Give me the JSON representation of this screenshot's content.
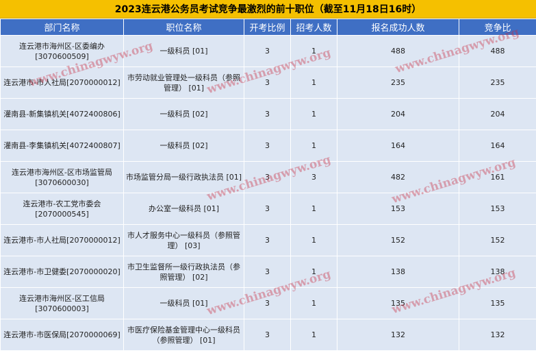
{
  "title": "2023连云港公务员考试竞争最激烈的前十职位（截至11月18日16时）",
  "columns": [
    "部门名称",
    "职位名称",
    "开考比例",
    "招考人数",
    "报名成功人数",
    "竞争比"
  ],
  "rows": [
    {
      "dept": "连云港市海州区-区委编办[3070600509]",
      "position": "一级科员 [01]",
      "ratio": "3",
      "hires": "1",
      "applicants": "488",
      "competition": "488"
    },
    {
      "dept": "连云港市-市人社局[2070000012]",
      "position": "市劳动就业管理处一级科员（参照管理） [01]",
      "ratio": "3",
      "hires": "1",
      "applicants": "235",
      "competition": "235"
    },
    {
      "dept": "灌南县-新集镇机关[4072400806]",
      "position": "一级科员 [02]",
      "ratio": "3",
      "hires": "1",
      "applicants": "204",
      "competition": "204"
    },
    {
      "dept": "灌南县-李集镇机关[4072400807]",
      "position": "一级科员 [02]",
      "ratio": "3",
      "hires": "1",
      "applicants": "164",
      "competition": "164"
    },
    {
      "dept": "连云港市海州区-区市场监管局 [3070600030]",
      "position": "市场监管分局一级行政执法员 [01]",
      "ratio": "3",
      "hires": "3",
      "applicants": "482",
      "competition": "161"
    },
    {
      "dept": "连云港市-农工党市委会[2070000545]",
      "position": "办公室一级科员 [01]",
      "ratio": "3",
      "hires": "1",
      "applicants": "153",
      "competition": "153"
    },
    {
      "dept": "连云港市-市人社局[2070000012]",
      "position": "市人才服务中心一级科员（参照管理） [03]",
      "ratio": "3",
      "hires": "1",
      "applicants": "152",
      "competition": "152"
    },
    {
      "dept": "连云港市-市卫健委[2070000020]",
      "position": "市卫生监督所一级行政执法员（参照管理） [02]",
      "ratio": "3",
      "hires": "1",
      "applicants": "138",
      "competition": "138"
    },
    {
      "dept": "连云港市海州区-区工信局[3070600003]",
      "position": "一级科员 [01]",
      "ratio": "3",
      "hires": "1",
      "applicants": "135",
      "competition": "135"
    },
    {
      "dept": "连云港市-市医保局[2070000069]",
      "position": "市医疗保险基金管理中心一级科员（参照管理） [01]",
      "ratio": "3",
      "hires": "1",
      "applicants": "132",
      "competition": "132"
    }
  ],
  "watermark_text": "www.chinagwyw.org",
  "colors": {
    "title_bg": "#f5c000",
    "header_bg": "#3f6fc4",
    "cell_bg": "#dde6f3",
    "watermark": "#c8283c"
  }
}
